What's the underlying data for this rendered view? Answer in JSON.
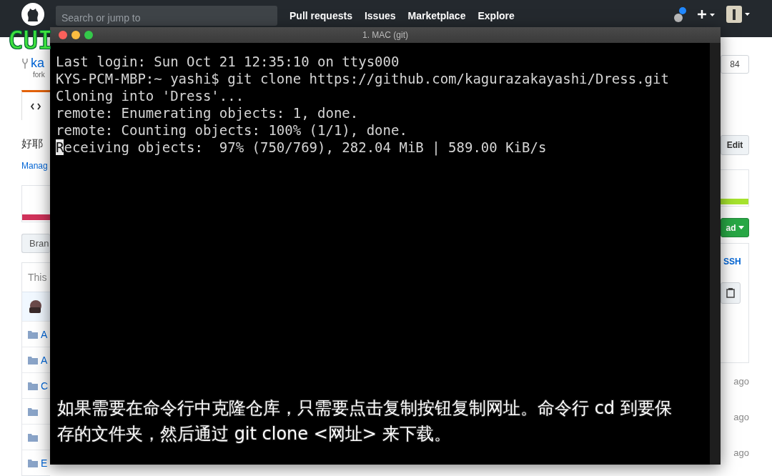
{
  "header": {
    "search": {
      "placeholder": "Search or jump to"
    },
    "nav": [
      "Pull requests",
      "Issues",
      "Marketplace",
      "Explore"
    ]
  },
  "repo": {
    "name": "ka",
    "fork_note": "fork",
    "count": "84",
    "description": "好耶",
    "manage_topics": "Manag",
    "edit_button": "Edit",
    "branch_button": "Bran",
    "clone_button": "ad",
    "ssh_link": "SSH",
    "file_header": "This"
  },
  "files": [
    {
      "kind": "folder",
      "name": "A"
    },
    {
      "kind": "folder",
      "name": "A"
    },
    {
      "kind": "folder",
      "name": "C"
    },
    {
      "kind": "folder"
    },
    {
      "kind": "folder"
    },
    {
      "kind": "folder",
      "name": "E"
    }
  ],
  "ages": [
    "ago",
    "ago",
    "ago"
  ],
  "overlay_label": "CUI",
  "terminal": {
    "title": "1. MAC (git)",
    "lines": [
      {
        "text": "Last login: Sun Oct 21 12:35:10 on ttys000",
        "cursor": false
      },
      {
        "text": "KYS-PCM-MBP:~ yashi$ git clone https://github.com/kagurazakayashi/Dress.git",
        "cursor": false
      },
      {
        "text": "Cloning into 'Dress'...",
        "cursor": false
      },
      {
        "text": "remote: Enumerating objects: 1, done.",
        "cursor": false
      },
      {
        "text": "remote: Counting objects: 100% (1/1), done.",
        "cursor": false
      },
      {
        "text": "Receiving objects:  97% (750/769), 282.04 MiB | 589.00 KiB/s",
        "cursor": true
      }
    ]
  },
  "subtitles": [
    "如果需要在命令行中克隆仓库，只需要点击复制按钮复制网址。命令行 cd 到要保",
    "存的文件夹，然后通过 git clone <网址> 来下载。"
  ]
}
